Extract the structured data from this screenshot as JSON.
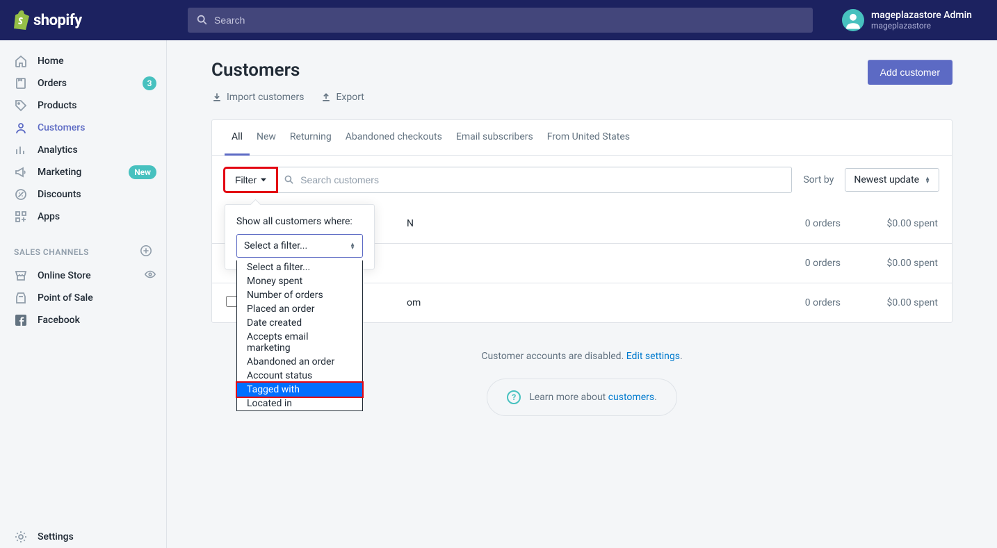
{
  "brand": "shopify",
  "search_placeholder": "Search",
  "user": {
    "name": "mageplazastore Admin",
    "store": "mageplazastore"
  },
  "sidebar": {
    "items": [
      {
        "label": "Home"
      },
      {
        "label": "Orders",
        "badge": "3"
      },
      {
        "label": "Products"
      },
      {
        "label": "Customers"
      },
      {
        "label": "Analytics"
      },
      {
        "label": "Marketing",
        "badge": "New"
      },
      {
        "label": "Discounts"
      },
      {
        "label": "Apps"
      }
    ],
    "channels_header": "SALES CHANNELS",
    "channels": [
      {
        "label": "Online Store"
      },
      {
        "label": "Point of Sale"
      },
      {
        "label": "Facebook"
      }
    ],
    "settings": "Settings"
  },
  "page": {
    "title": "Customers",
    "import": "Import customers",
    "export": "Export",
    "add_btn": "Add customer"
  },
  "tabs": [
    "All",
    "New",
    "Returning",
    "Abandoned checkouts",
    "Email subscribers",
    "From United States"
  ],
  "filter": {
    "button": "Filter",
    "search_placeholder": "Search customers",
    "sort_label": "Sort by",
    "sort_value": "Newest update",
    "popover_label": "Show all customers where:",
    "select_placeholder": "Select a filter...",
    "options": [
      "Select a filter...",
      "Money spent",
      "Number of orders",
      "Placed an order",
      "Date created",
      "Accepts email marketing",
      "Abandoned an order",
      "Account status",
      "Tagged with",
      "Located in"
    ]
  },
  "rows": [
    {
      "name_tail": "N",
      "orders": "0 orders",
      "spent": "$0.00 spent"
    },
    {
      "name_tail": "",
      "orders": "0 orders",
      "spent": "$0.00 spent"
    },
    {
      "name_tail": "om",
      "orders": "0 orders",
      "spent": "$0.00 spent"
    }
  ],
  "footer": {
    "disabled_text": "Customer accounts are disabled. ",
    "edit_link": "Edit settings",
    "learn_prefix": "Learn more about ",
    "learn_link": "customers"
  }
}
